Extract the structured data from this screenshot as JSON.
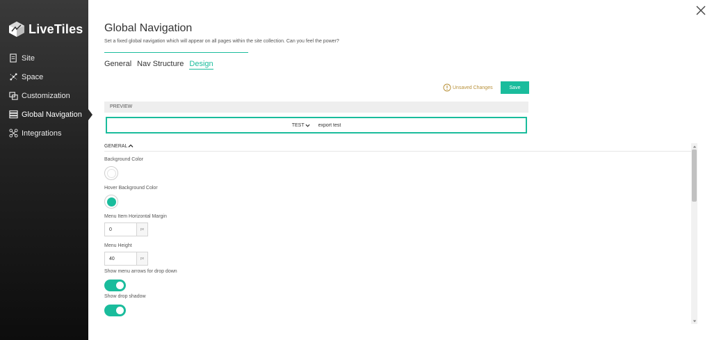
{
  "brand": {
    "name": "LiveTiles"
  },
  "sidebar": {
    "items": [
      {
        "label": "Site",
        "icon": "file-icon"
      },
      {
        "label": "Space",
        "icon": "space-icon"
      },
      {
        "label": "Customization",
        "icon": "customization-icon"
      },
      {
        "label": "Global Navigation",
        "icon": "list-icon",
        "active": true
      },
      {
        "label": "Integrations",
        "icon": "integrations-icon"
      }
    ]
  },
  "page": {
    "title": "Global Navigation",
    "subtitle": "Set a fixed global navigation which will appear on all pages within the site collection. Can you feel the power?"
  },
  "tabs": [
    {
      "label": "General"
    },
    {
      "label": "Nav Structure"
    },
    {
      "label": "Design",
      "active": true
    }
  ],
  "toolbar": {
    "unsaved_label": "Unsaved Changes",
    "save_label": "Save"
  },
  "preview": {
    "header": "PREVIEW",
    "items": [
      {
        "label": "TEST",
        "has_dropdown": true
      },
      {
        "label": "export test",
        "has_dropdown": false
      }
    ]
  },
  "general": {
    "header": "GENERAL",
    "fields": {
      "background_color": {
        "label": "Background Color",
        "value": "#ffffff"
      },
      "hover_background_color": {
        "label": "Hover Background Color",
        "value": "#1abc9c"
      },
      "menu_item_horizontal_margin": {
        "label": "Menu Item Horizontal Margin",
        "value": "0",
        "unit": "px"
      },
      "menu_height": {
        "label": "Menu Height",
        "value": "40",
        "unit": "px"
      },
      "show_menu_arrows": {
        "label": "Show menu arrows for drop down",
        "on": true
      },
      "show_drop_shadow": {
        "label": "Show drop shadow",
        "on": true
      }
    }
  },
  "colors": {
    "accent": "#1abc9c",
    "warning": "#b8913a",
    "sidebar_bg": "#222222"
  }
}
